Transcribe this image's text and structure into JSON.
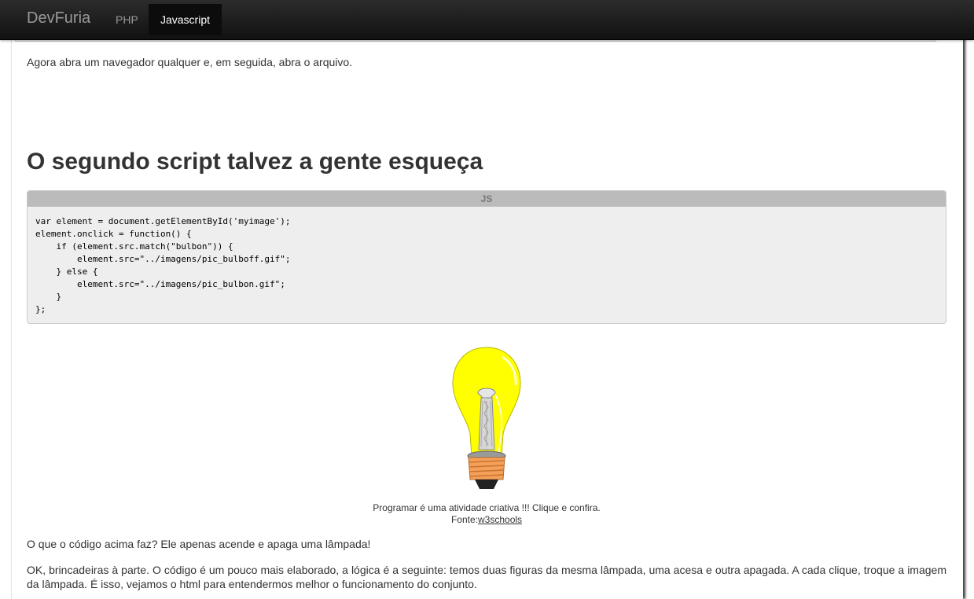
{
  "navbar": {
    "brand": "DevFuria",
    "items": [
      {
        "label": "PHP",
        "active": false
      },
      {
        "label": "Javascript",
        "active": true
      }
    ]
  },
  "content": {
    "intro_text": "Agora abra um navegador qualquer e, em seguida, abra o arquivo.",
    "heading": "O segundo script talvez a gente esqueça",
    "code_block": {
      "language_tab": "JS",
      "code": "var element = document.getElementById('myimage');\nelement.onclick = function() {\n    if (element.src.match(\"bulbon\")) {\n        element.src=\"../imagens/pic_bulboff.gif\";\n    } else {\n        element.src=\"../imagens/pic_bulbon.gif\";\n    }\n};"
    },
    "figure": {
      "caption": "Programar é uma atividade criativa !!! Clique e confira.",
      "source_prefix": "Fonte:",
      "source_link": "w3schools"
    },
    "paragraph_1": "O que o código acima faz? Ele apenas acende e apaga uma lâmpada!",
    "paragraph_2": "OK, brincadeiras à parte. O código é um pouco mais elaborado, a lógica é a seguinte: temos duas figuras da mesma lâmpada, uma acesa e outra apagada. A cada clique, troque a imagem da lâmpada. É isso, vejamos o html para entendermos melhor o funcionamento do conjunto."
  },
  "colors": {
    "navbar_bg": "#1b1b1b",
    "bulb_glass": "#ffff00",
    "bulb_base": "#f5a05a"
  }
}
